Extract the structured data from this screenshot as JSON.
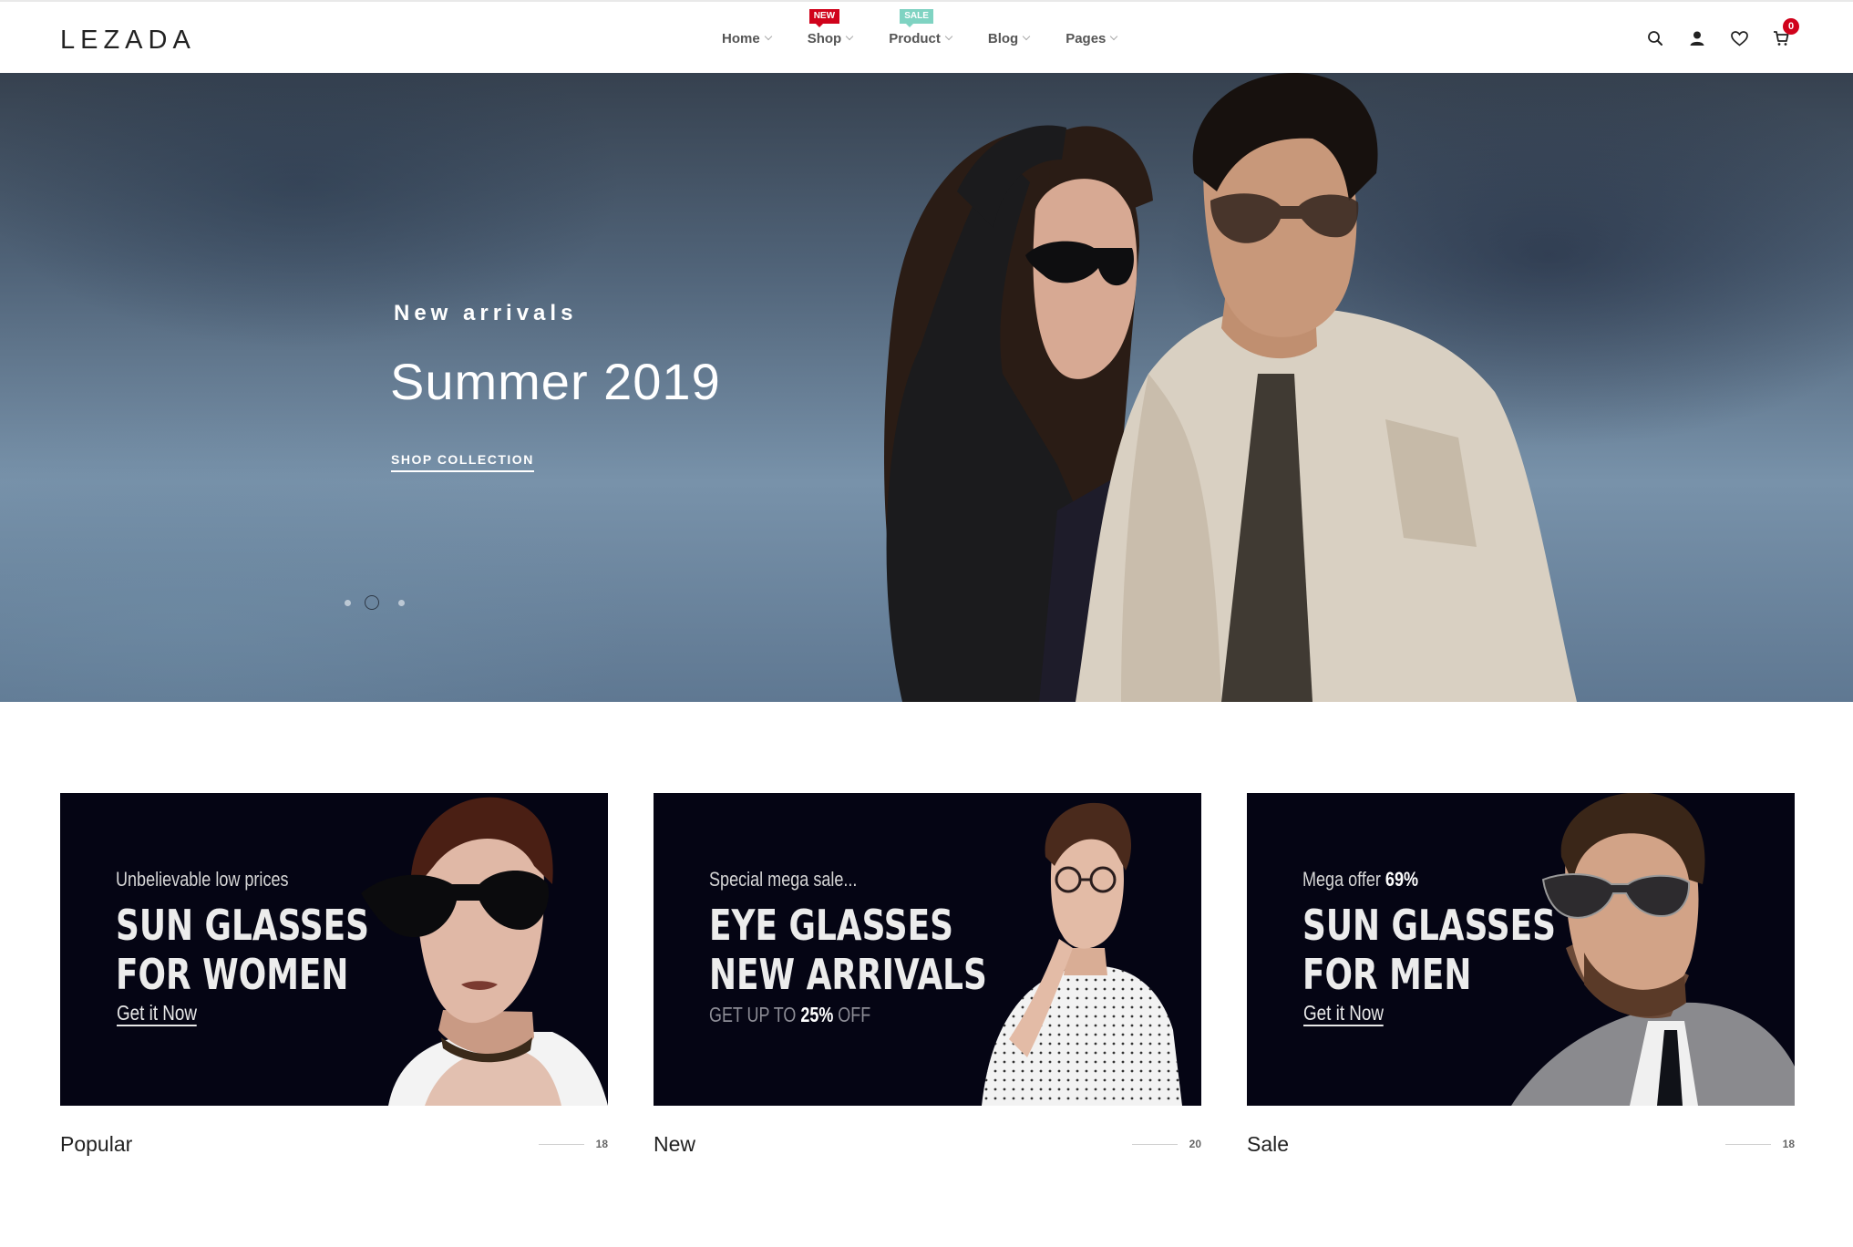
{
  "header": {
    "logo": "LEZADA",
    "nav": [
      {
        "label": "Home",
        "badge": ""
      },
      {
        "label": "Shop",
        "badge": "NEW"
      },
      {
        "label": "Product",
        "badge": "SALE"
      },
      {
        "label": "Blog",
        "badge": ""
      },
      {
        "label": "Pages",
        "badge": ""
      }
    ],
    "icons": [
      "search-icon",
      "user-icon",
      "heart-icon",
      "cart-icon"
    ],
    "cart_count": "0",
    "colors": {
      "badge_new": "#d0021b",
      "badge_sale": "#7fd3c2",
      "cart_badge": "#d0021b"
    }
  },
  "hero": {
    "eyebrow": "New arrivals",
    "title": "Summer 2019",
    "cta": "SHOP COLLECTION",
    "slides": 3,
    "active_slide": 2
  },
  "banners": [
    {
      "kicker": "Unbelievable low prices",
      "kicker_strong": "",
      "line1": "SUN GLASSES",
      "line2": "FOR WOMEN",
      "link": "Get it Now"
    },
    {
      "kicker": "Special mega sale...",
      "kicker_strong": "",
      "line1": "EYE GLASSES",
      "line2": "NEW ARRIVALS",
      "sub_pre": "GET UP TO ",
      "sub_strong": "25%",
      "sub_post": " OFF"
    },
    {
      "kicker": "Mega offer ",
      "kicker_strong": "69%",
      "line1": "SUN GLASSES",
      "line2": "FOR MEN",
      "link": "Get it Now"
    }
  ],
  "categories": [
    {
      "name": "Popular",
      "count": "18"
    },
    {
      "name": "New",
      "count": "20"
    },
    {
      "name": "Sale",
      "count": "18"
    }
  ]
}
